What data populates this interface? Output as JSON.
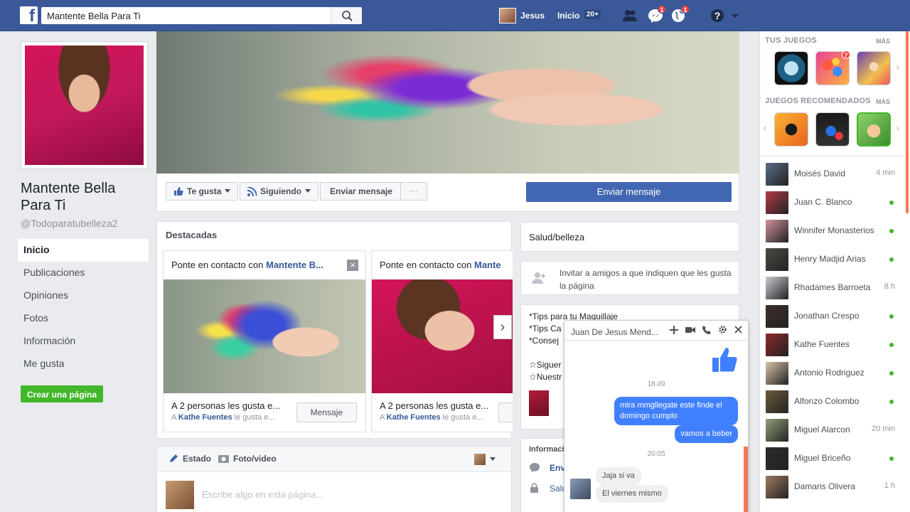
{
  "topbar": {
    "logo": "f",
    "search_value": "Mantente Bella Para Ti",
    "user_name": "Jesus",
    "home_label": "Inicio",
    "home_count": "20+",
    "messages_badge": "1",
    "notifications_badge": "1"
  },
  "page": {
    "name": "Mantente Bella Para Ti",
    "handle": "@Todoparatubelleza2",
    "nav": [
      "Inicio",
      "Publicaciones",
      "Opiniones",
      "Fotos",
      "Información",
      "Me gusta"
    ],
    "create_page": "Crear una página"
  },
  "actions": {
    "like": "Te gusta",
    "following": "Siguiendo",
    "send_message": "Enviar mensaje",
    "more": "···",
    "primary": "Enviar mensaje"
  },
  "featured": {
    "title": "Destacadas",
    "cards": [
      {
        "head": "Ponte en contacto con",
        "name": "Mantente B...",
        "text": "A 2 personas les gusta e...",
        "sub_prefix": "A",
        "sub_name": "Kathe Fuentes",
        "sub_suffix": "le gusta e...",
        "button": "Mensaje"
      },
      {
        "head": "Ponte en contacto con",
        "name": "Mante",
        "text": "A 2 personas les gusta e...",
        "sub_prefix": "A",
        "sub_name": "Kathe Fuentes",
        "sub_suffix": "le gusta e...",
        "button": ""
      }
    ]
  },
  "composer": {
    "tab_status": "Estado",
    "tab_photo": "Foto/video",
    "placeholder": "Escribe algo en esta página..."
  },
  "about": {
    "category": "Salud/belleza",
    "invite": "Invitar a amigos a que indiquen que les gusta la página",
    "tips": [
      "*Tips para tu Maquillaje",
      "*Tips Ca",
      "*Consej",
      "",
      "☆Siguer",
      "☆Nuestr"
    ],
    "info_label": "Informaci",
    "info_row1": "Env",
    "info_row2": "Salu"
  },
  "chat": {
    "name": "Juan De Jesus Mend...",
    "time1": "18:49",
    "msg1": "mira mmgllegate este finde el domingo cumplo",
    "msg2": "vamos a beber",
    "time2": "20:05",
    "reply1": "Jaja si va",
    "reply2": "El viernes mismo"
  },
  "sidebar": {
    "your_games": "TUS JUEGOS",
    "more": "MÁS",
    "recommended": "JUEGOS RECOMENDADOS",
    "game_badge": "7",
    "contacts": [
      {
        "name": "Moisés David",
        "status": "4 min",
        "color": "#5a6e8a"
      },
      {
        "name": "Juan C. Blanco",
        "status": "online",
        "color": "#b53a4a"
      },
      {
        "name": "Winnifer Monasterios",
        "status": "online",
        "color": "#d1909a"
      },
      {
        "name": "Henry Madjid Arias",
        "status": "online",
        "color": "#4c4a45"
      },
      {
        "name": "Rhadames Barroeta",
        "status": "8 h",
        "color": "#c9ccd1"
      },
      {
        "name": "Jonathan Crespo",
        "status": "online",
        "color": "#3e2f2a"
      },
      {
        "name": "Kathe Fuentes",
        "status": "online",
        "color": "#8e2a2a"
      },
      {
        "name": "Antonio Rodriguez",
        "status": "online",
        "color": "#d8c3a5"
      },
      {
        "name": "Alfonzo Colombo",
        "status": "online",
        "color": "#6b5a3e"
      },
      {
        "name": "Miguel Alarcon",
        "status": "20 min",
        "color": "#8fa07a"
      },
      {
        "name": "Miguel Briceño",
        "status": "online",
        "color": "#2e2c2a"
      },
      {
        "name": "Damaris Olivera",
        "status": "1 h",
        "color": "#a07a60"
      }
    ]
  }
}
